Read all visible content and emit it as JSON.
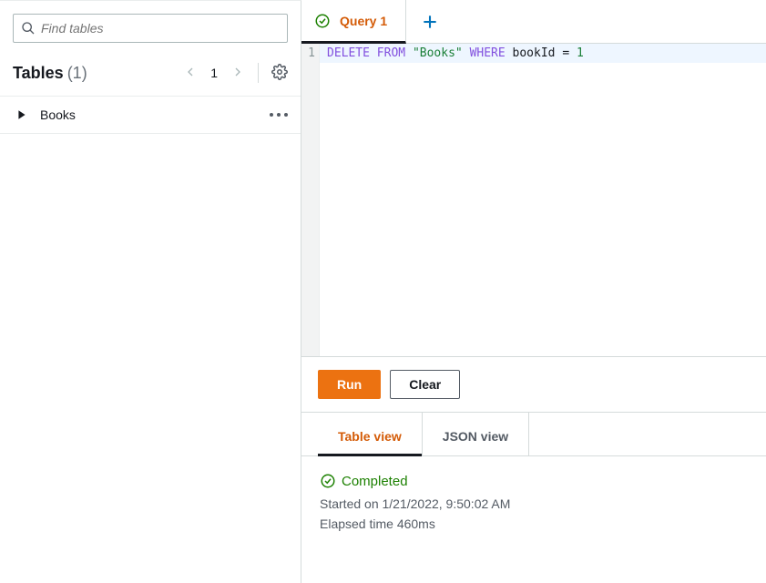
{
  "sidebar": {
    "search_placeholder": "Find tables",
    "header_label": "Tables",
    "count_label": "(1)",
    "page_number": "1",
    "items": [
      {
        "name": "Books"
      }
    ]
  },
  "tabs": {
    "items": [
      {
        "label": "Query 1"
      }
    ]
  },
  "editor": {
    "line_number": "1",
    "code": {
      "kw1": "DELETE",
      "kw2": "FROM",
      "str": "\"Books\"",
      "kw3": "WHERE",
      "ident": "bookId =",
      "num": "1"
    }
  },
  "actions": {
    "run": "Run",
    "clear": "Clear"
  },
  "result_tabs": {
    "table": "Table view",
    "json": "JSON view"
  },
  "status": {
    "label": "Completed",
    "started": "Started on 1/21/2022, 9:50:02 AM",
    "elapsed": "Elapsed time 460ms"
  }
}
